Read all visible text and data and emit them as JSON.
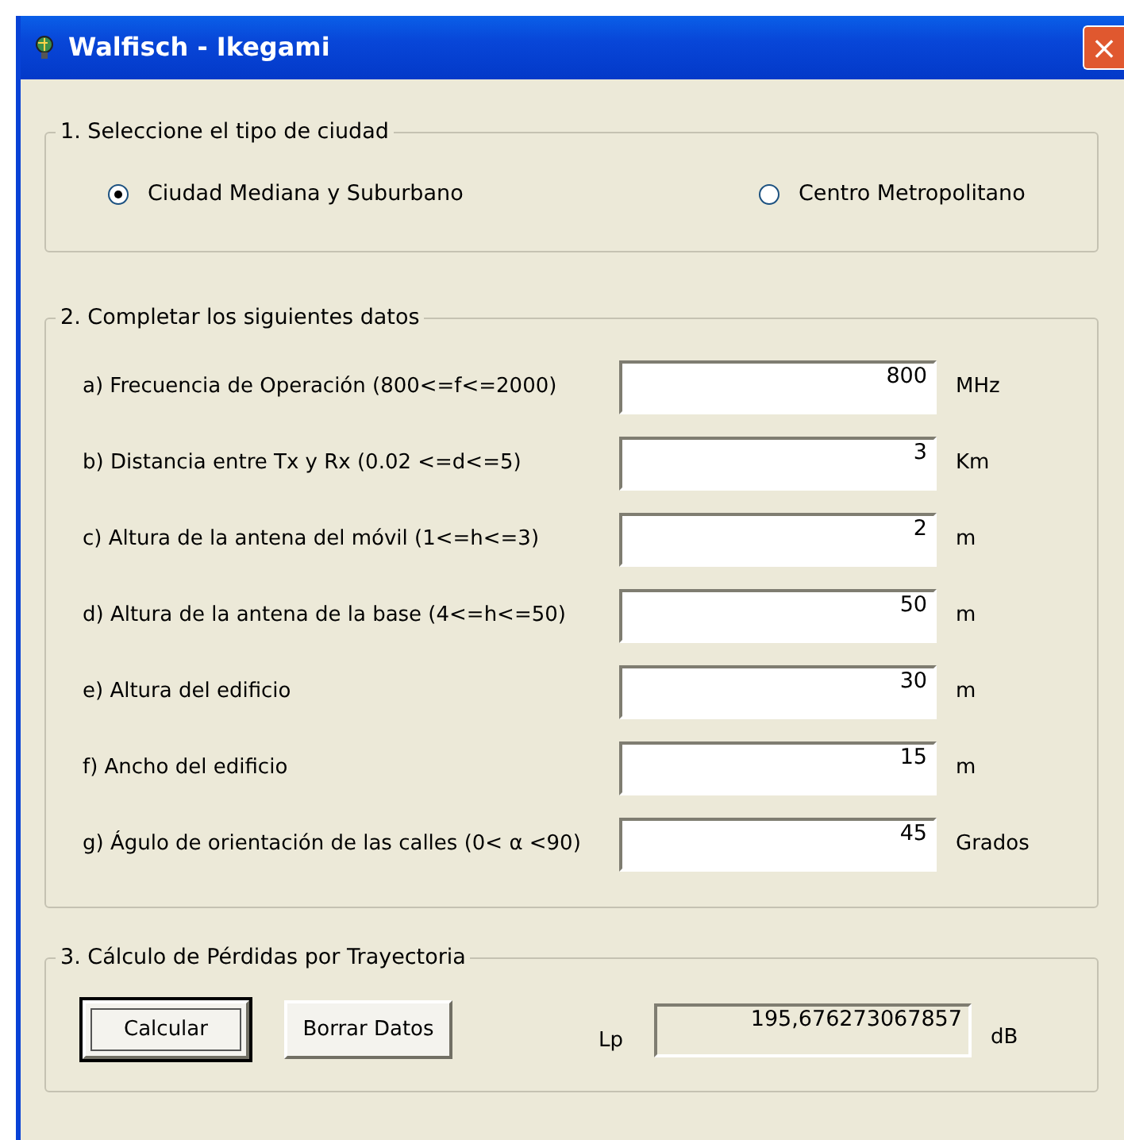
{
  "window": {
    "title": "Walfisch - Ikegami",
    "close_button": "×"
  },
  "city_group": {
    "legend": "1. Seleccione el tipo de ciudad",
    "options": [
      {
        "label": "Ciudad Mediana y Suburbano",
        "selected": true
      },
      {
        "label": "Centro Metropolitano",
        "selected": false
      }
    ]
  },
  "data_group": {
    "legend": "2. Completar los siguientes datos",
    "fields": [
      {
        "label": "a) Frecuencia de Operación (800<=f<=2000)",
        "value": "800",
        "unit": "MHz"
      },
      {
        "label": "b) Distancia entre Tx y Rx (0.02 <=d<=5)",
        "value": "3",
        "unit": "Km"
      },
      {
        "label": "c) Altura de la antena del móvil (1<=h<=3)",
        "value": "2",
        "unit": "m"
      },
      {
        "label": "d) Altura de la antena de la base (4<=h<=50)",
        "value": "50",
        "unit": "m"
      },
      {
        "label": "e) Altura del edificio",
        "value": "30",
        "unit": "m"
      },
      {
        "label": "f) Ancho del edificio",
        "value": "15",
        "unit": "m"
      },
      {
        "label": "g) Águlo de orientación de las calles (0<  α <90)",
        "value": "45",
        "unit": "Grados"
      }
    ]
  },
  "result_group": {
    "legend": "3. Cálculo de Pérdidas por Trayectoria",
    "buttons": [
      {
        "label": "Calcular",
        "focused": true
      },
      {
        "label": "Borrar Datos",
        "focused": false
      }
    ],
    "output_label": "Lp",
    "output_value": "195,676273067857",
    "output_unit": "dB"
  }
}
